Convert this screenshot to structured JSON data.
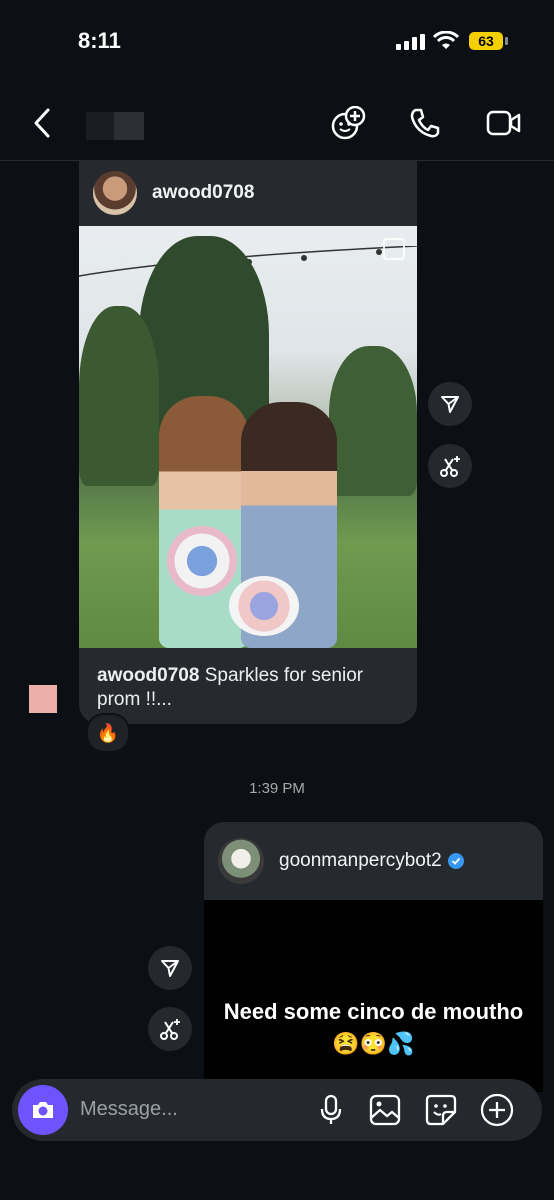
{
  "status_bar": {
    "time": "8:11",
    "battery": "63"
  },
  "header": {
    "back_icon": "chevron-left-icon",
    "icons": [
      "effects-add-icon",
      "phone-icon",
      "video-icon"
    ]
  },
  "post": {
    "author": "awood0708",
    "caption_user": "awood0708",
    "caption_text": " Sparkles for senior prom !!...",
    "reaction": "🔥"
  },
  "timestamp": "1:39 PM",
  "story": {
    "author": "goonmanpercybot2",
    "text": "Need some cinco de moutho 😫😳💦"
  },
  "composer": {
    "placeholder": "Message..."
  },
  "colors": {
    "background": "#0c1014",
    "card": "#262a2f",
    "camera": "#6f53ff",
    "verified": "#3897f0"
  }
}
